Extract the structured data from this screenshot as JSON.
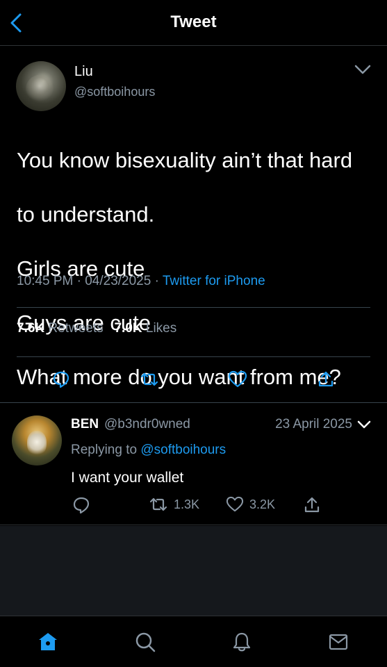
{
  "header": {
    "title": "Tweet"
  },
  "tweet": {
    "author_name": "Liu",
    "author_handle": "@softboihours",
    "lines": [
      "You know bisexuality ain’t that hard",
      "to understand.",
      "Girls are cute",
      "Guys are cute",
      "What more do you want from me?"
    ],
    "time": "10:45 PM",
    "date": "04/23/2025",
    "source": "Twitter for iPhone",
    "retweets_count": "7.6K",
    "retweets_label": "Retweets",
    "likes_count": "7.0K",
    "likes_label": "Likes"
  },
  "reply": {
    "author_name": "BEN",
    "author_handle": "@b3ndr0wned",
    "date": "23 April 2025",
    "replying_prefix": "Replying to",
    "replying_handle": "@softboihours",
    "text": "I want your wallet",
    "retweets": "1.3K",
    "likes": "3.2K"
  },
  "tabbar": {
    "active": "home",
    "items": [
      "home-icon",
      "search-icon",
      "notifications-icon",
      "messages-icon"
    ]
  },
  "colors": {
    "accent": "#1d9bf0",
    "muted": "#8b98a5",
    "background": "#000000"
  }
}
